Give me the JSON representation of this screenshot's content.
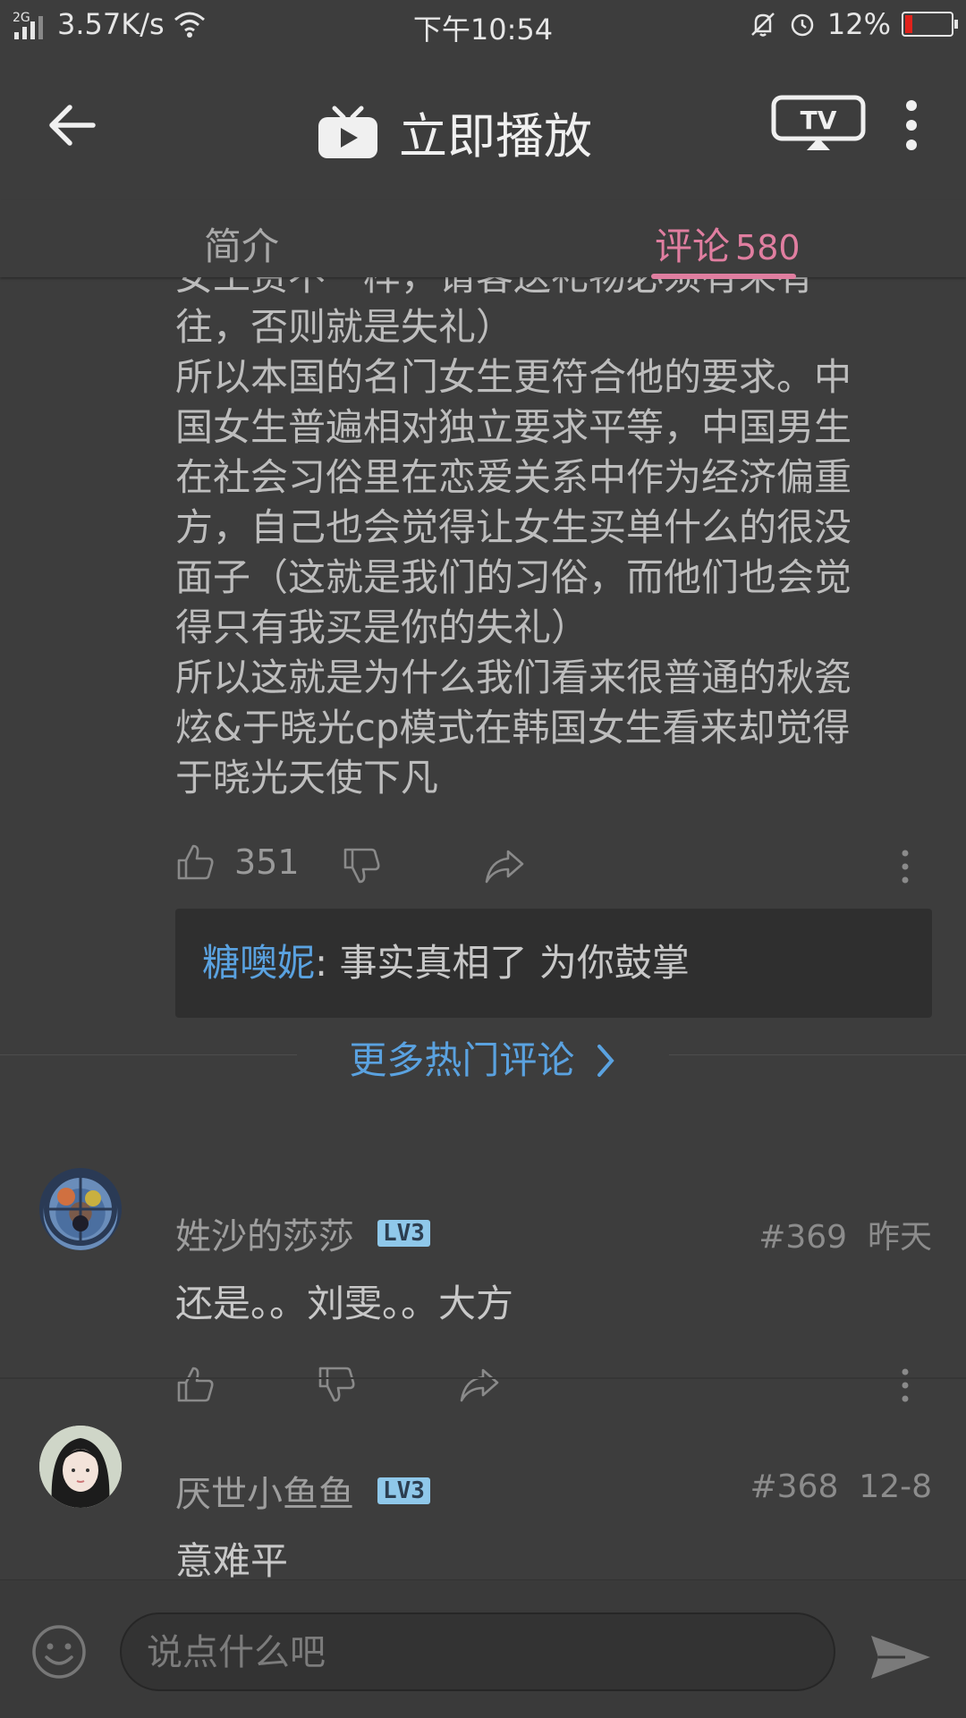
{
  "status_bar": {
    "network": "2G",
    "speed": "3.57K/s",
    "time": "下午10:54",
    "battery": "12%"
  },
  "app_bar": {
    "title": "立即播放"
  },
  "tabs": {
    "intro": "简介",
    "comments": "评论",
    "comments_count": "580"
  },
  "comment_body": {
    "lines": [
      "女工资不一样，请客送礼物必须有来有",
      "往，否则就是失礼）",
      "所以本国的名门女生更符合他的要求。中",
      "国女生普遍相对独立要求平等，中国男生",
      "在社会习俗里在恋爱关系中作为经济偏重",
      "方，自己也会觉得让女生买单什么的很没",
      "面子（这就是我们的习俗，而他们也会觉",
      "得只有我买是你的失礼）",
      "所以这就是为什么我们看来很普通的秋瓷",
      "炫&于晓光cp模式在韩国女生看来却觉得",
      "于晓光天使下凡"
    ],
    "likes": "351"
  },
  "reply": {
    "name": "糖噢妮",
    "sep": ": ",
    "text": "事实真相了  为你鼓掌"
  },
  "more_hot_label": "更多热门评论",
  "comments": [
    {
      "name": "姓沙的莎莎",
      "level": "LV3",
      "floor": "#369",
      "date": "昨天",
      "text": "还是。。刘雯。。大方"
    },
    {
      "name": "厌世小鱼鱼",
      "level": "LV3",
      "floor": "#368",
      "date": "12-8",
      "text": "意难平"
    }
  ],
  "input": {
    "placeholder": "说点什么吧"
  },
  "colors": {
    "accent": "#e07ea0",
    "link": "#5aa2e0",
    "background": "#3d3d3d"
  }
}
